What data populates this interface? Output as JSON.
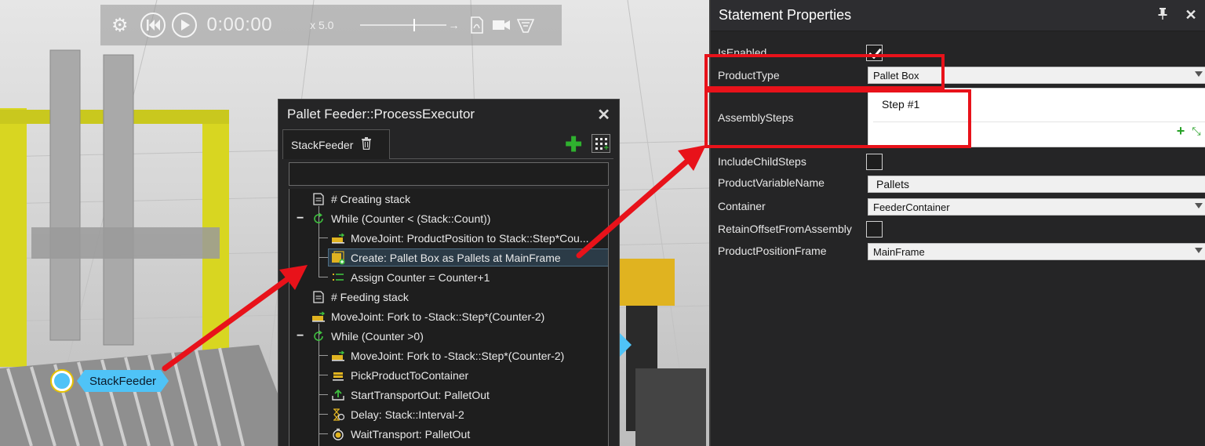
{
  "playback": {
    "time": "0:00:00",
    "speed": "x 5.0",
    "icons": [
      "gear-icon",
      "rewind-icon",
      "play-icon",
      "arrow-right-icon",
      "pdf-icon",
      "camera-icon",
      "vr-icon"
    ]
  },
  "viewport": {
    "node_label": "StackFeeder"
  },
  "process_executor": {
    "title": "Pallet Feeder::ProcessExecutor",
    "tab_label": "StackFeeder",
    "search_value": "",
    "rows": [
      {
        "text": "# Creating stack",
        "icon": "comment-icon"
      },
      {
        "text": "While (Counter < (Stack::Count))",
        "icon": "loop-icon"
      },
      {
        "text": "MoveJoint: ProductPosition to Stack::Step*Cou...",
        "icon": "move-joint-icon"
      },
      {
        "text": "Create: Pallet Box as Pallets at MainFrame",
        "icon": "create-icon"
      },
      {
        "text": "Assign Counter = Counter+1",
        "icon": "assign-icon"
      },
      {
        "text": "# Feeding stack",
        "icon": "comment-icon"
      },
      {
        "text": "MoveJoint: Fork to -Stack::Step*(Counter-2)",
        "icon": "move-joint-icon"
      },
      {
        "text": "While (Counter >0)",
        "icon": "loop-icon"
      },
      {
        "text": "MoveJoint: Fork to -Stack::Step*(Counter-2)",
        "icon": "move-joint-icon"
      },
      {
        "text": "PickProductToContainer",
        "icon": "pick-icon"
      },
      {
        "text": "StartTransportOut: PalletOut",
        "icon": "transport-out-icon"
      },
      {
        "text": "Delay: Stack::Interval-2",
        "icon": "delay-icon"
      },
      {
        "text": "WaitTransport: PalletOut",
        "icon": "wait-icon"
      }
    ]
  },
  "properties": {
    "title": "Statement Properties",
    "fields": {
      "is_enabled": {
        "label": "IsEnabled",
        "checked": true
      },
      "product_type": {
        "label": "ProductType",
        "value": "Pallet Box"
      },
      "assembly_steps": {
        "label": "AssemblySteps",
        "items": [
          "Step #1"
        ]
      },
      "include_child_steps": {
        "label": "IncludeChildSteps",
        "checked": false
      },
      "product_variable_name": {
        "label": "ProductVariableName",
        "value": "Pallets"
      },
      "container": {
        "label": "Container",
        "value": "FeederContainer"
      },
      "retain_offset": {
        "label": "RetainOffsetFromAssembly",
        "checked": false
      },
      "product_position_frame": {
        "label": "ProductPositionFrame",
        "value": "MainFrame"
      }
    }
  },
  "colors": {
    "annotation_red": "#e8121a",
    "node_blue": "#4fc3f7",
    "add_green": "#2fb12f",
    "frame_yellow": "#d8d621"
  }
}
